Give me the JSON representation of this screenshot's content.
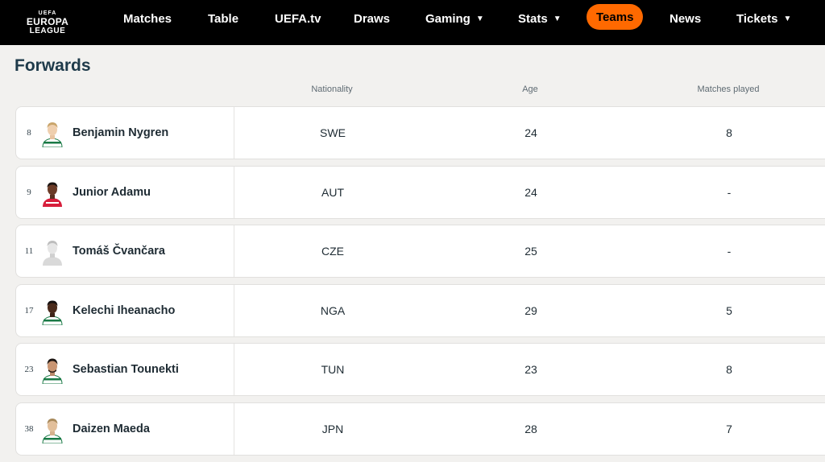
{
  "brand": {
    "line1": "UEFA",
    "line2": "EUROPA",
    "line3": "LEAGUE"
  },
  "nav": [
    {
      "label": "Matches",
      "dropdown": false,
      "active": false
    },
    {
      "label": "Table",
      "dropdown": false,
      "active": false
    },
    {
      "label": "UEFA.tv",
      "dropdown": false,
      "active": false
    },
    {
      "label": "Draws",
      "dropdown": false,
      "active": false
    },
    {
      "label": "Gaming",
      "dropdown": true,
      "active": false
    },
    {
      "label": "Stats",
      "dropdown": true,
      "active": false
    },
    {
      "label": "Teams",
      "dropdown": false,
      "active": true
    },
    {
      "label": "News",
      "dropdown": false,
      "active": false
    },
    {
      "label": "Tickets",
      "dropdown": true,
      "active": false
    }
  ],
  "section": {
    "title": "Forwards",
    "columns": {
      "nationality": "Nationality",
      "age": "Age",
      "matches": "Matches played"
    }
  },
  "players": [
    {
      "number": "8",
      "name": "Benjamin Nygren",
      "nationality": "SWE",
      "age": "24",
      "matches": "8",
      "avatar": "player-photo"
    },
    {
      "number": "9",
      "name": "Junior Adamu",
      "nationality": "AUT",
      "age": "24",
      "matches": "-",
      "avatar": "player-photo"
    },
    {
      "number": "11",
      "name": "Tomáš Čvančara",
      "nationality": "CZE",
      "age": "25",
      "matches": "-",
      "avatar": "placeholder-silhouette"
    },
    {
      "number": "17",
      "name": "Kelechi Iheanacho",
      "nationality": "NGA",
      "age": "29",
      "matches": "5",
      "avatar": "player-photo"
    },
    {
      "number": "23",
      "name": "Sebastian Tounekti",
      "nationality": "TUN",
      "age": "23",
      "matches": "8",
      "avatar": "player-photo"
    },
    {
      "number": "38",
      "name": "Daizen Maeda",
      "nationality": "JPN",
      "age": "28",
      "matches": "7",
      "avatar": "player-photo"
    }
  ],
  "colors": {
    "nav_bg": "#000000",
    "active_pill": "#ff6900",
    "page_bg": "#f2f1ef",
    "row_bg": "#ffffff",
    "kit_green": "#1a7a46"
  }
}
